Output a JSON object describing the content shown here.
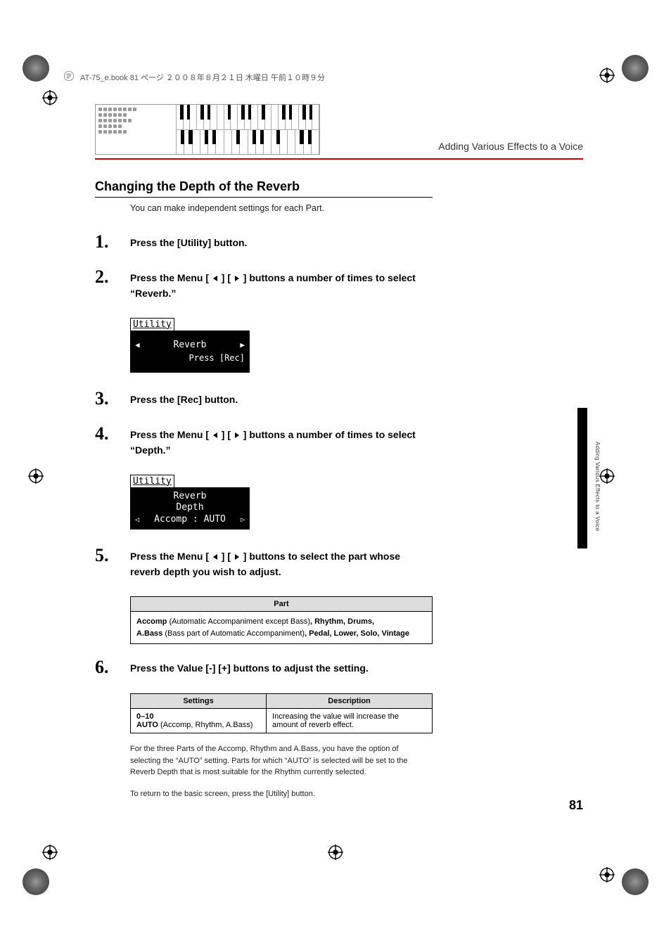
{
  "header_meta": "AT-75_e.book 81 ページ ２００８年８月２１日 木曜日 午前１０時９分",
  "chapter_title": "Adding Various Effects to a Voice",
  "section_title": "Changing the Depth of the Reverb",
  "intro": "You can make independent settings for each Part.",
  "steps": {
    "s1": "Press the [Utility] button.",
    "s2a": "Press the Menu [ ",
    "s2b": " ] [ ",
    "s2c": " ] buttons a number of times to select “Reverb.”",
    "s3": "Press the [Rec] button.",
    "s4a": "Press the Menu [ ",
    "s4b": " ] [ ",
    "s4c": " ] buttons a number of times to select “Depth.”",
    "s5a": "Press the Menu [ ",
    "s5b": " ] [ ",
    "s5c": " ] buttons to select the part whose reverb depth you wish to adjust.",
    "s6": "Press the Value [-] [+] buttons to adjust the setting."
  },
  "lcd1": {
    "title": "Utility",
    "center": "Reverb",
    "bottom": "Press [Rec]"
  },
  "lcd2": {
    "title": "Utility",
    "l1": "Reverb",
    "l2": "Depth",
    "l3": "Accomp : AUTO"
  },
  "part_table": {
    "header": "Part",
    "body_plain_1": "Accomp",
    "body_rest_1": " (Automatic Accompaniment except Bass)",
    "body_bold_2": ", Rhythm, Drums,",
    "body_plain_3": "A.Bass",
    "body_rest_3": " (Bass part of Automatic Accompaniment)",
    "body_bold_4": ", Pedal, Lower, Solo, Vintage"
  },
  "settings_table": {
    "h1": "Settings",
    "h2": "Description",
    "c1a": "0–10",
    "c1b_bold": "AUTO",
    "c1b_rest": " (Accomp, Rhythm, A.Bass)",
    "c2": "Increasing the value will increase the amount of reverb effect."
  },
  "note1": "For the three Parts of the Accomp, Rhythm and A.Bass, you have the option of selecting the “AUTO” setting. Parts for which “AUTO” is selected will be set to the Reverb Depth that is most suitable for the Rhythm currently selected.",
  "note2": "To return to the basic screen, press the [Utility] button.",
  "side_tab": "Adding Various Effects to a Voice",
  "page_num": "81"
}
